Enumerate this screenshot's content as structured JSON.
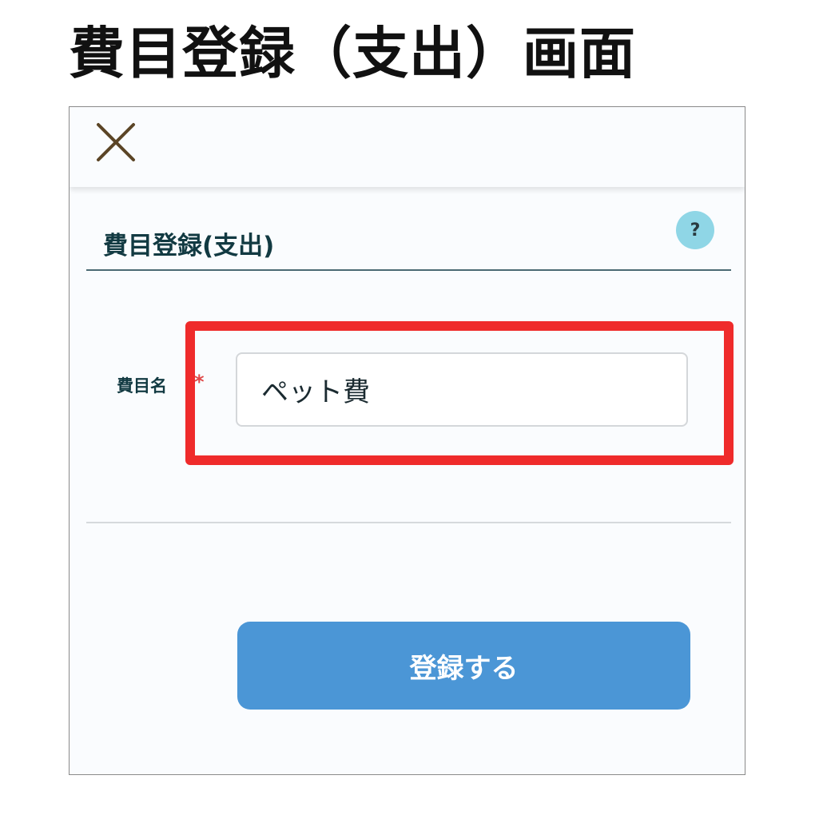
{
  "page": {
    "heading": "費目登録（支出）画面"
  },
  "dialog": {
    "close_icon": "close-icon",
    "title": "費目登録(支出)",
    "help_label": "?",
    "field": {
      "label": "費目名",
      "required_mark": "*",
      "value": "ペット費"
    },
    "submit_label": "登録する"
  },
  "colors": {
    "highlight": "#ef2b2b",
    "button": "#4b96d6",
    "help_badge": "#8fd6e6",
    "title_text": "#123a42",
    "required": "#e04848"
  }
}
